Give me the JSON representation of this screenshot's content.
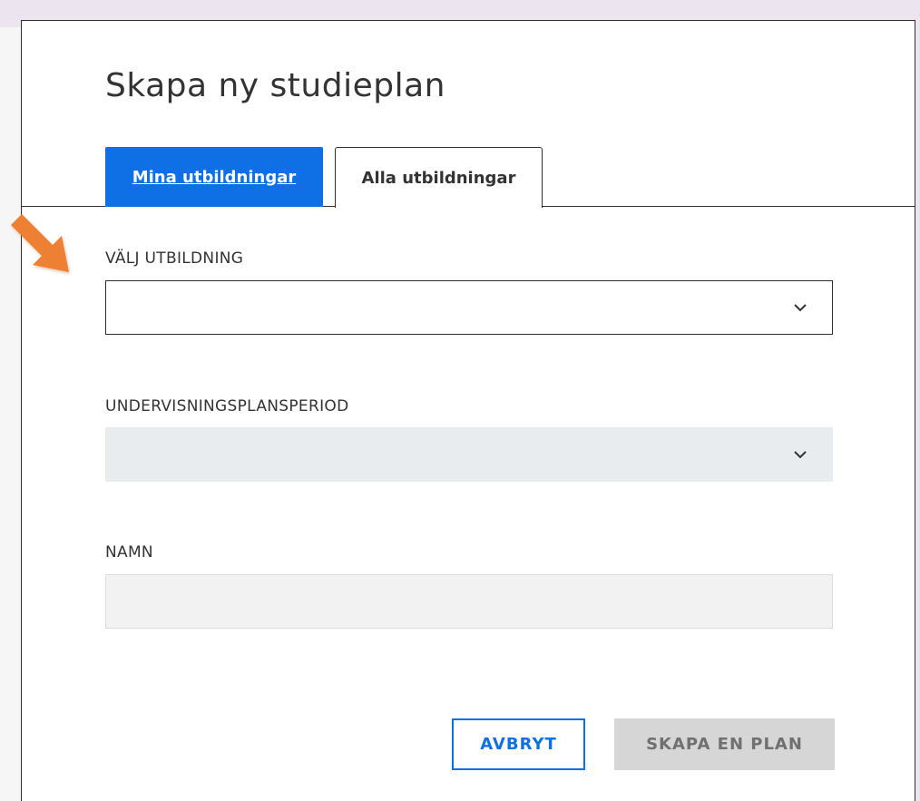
{
  "dialog": {
    "title": "Skapa ny studieplan"
  },
  "tabs": [
    {
      "label": "Mina utbildningar",
      "active": true
    },
    {
      "label": "Alla utbildningar",
      "active": false
    }
  ],
  "fields": {
    "education": {
      "label": "VÄLJ UTBILDNING",
      "value": "",
      "icon": "chevron-down-icon"
    },
    "period": {
      "label": "UNDERVISNINGSPLANSPERIOD",
      "value": "",
      "disabled": true,
      "icon": "chevron-down-icon"
    },
    "name": {
      "label": "NAMN",
      "value": "",
      "disabled": true
    }
  },
  "actions": {
    "cancel_label": "AVBRYT",
    "create_label": "SKAPA EN PLAN",
    "create_disabled": true
  },
  "annotation": {
    "icon": "arrow-pointer-icon",
    "color": "#ee8033"
  },
  "colors": {
    "accent": "#0f70e6",
    "disabled_button_bg": "#d6d6d6",
    "disabled_input_bg": "#e8ecef",
    "page_bg": "#ece4ee"
  }
}
